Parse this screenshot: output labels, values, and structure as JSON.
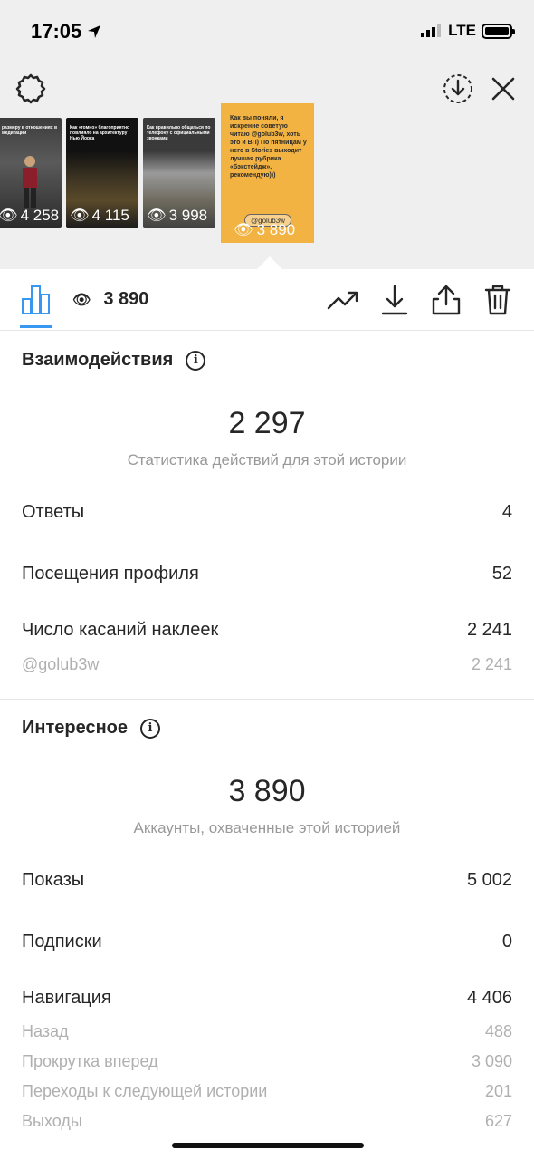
{
  "status": {
    "time": "17:05",
    "network": "LTE"
  },
  "stories": [
    {
      "caption": "размеру в отношениях в медитации",
      "views": "4 258"
    },
    {
      "caption": "Как «гомно» благоприятно повлияло на архитектуру Нью Йорка",
      "views": "4 115"
    },
    {
      "caption": "Как правильно общаться по телефону с официальными звонками",
      "views": "3 998"
    }
  ],
  "active_story": {
    "text": "Как вы поняли, я искренне советую читаю @golub3w, хоть это и ВП) По пятницам у него в Stories выходит лучшая рубрика «бэкстейдж», рекомендую)))",
    "sticker": "@golub3w",
    "views": "3 890"
  },
  "toolbar": {
    "views": "3 890"
  },
  "interactions": {
    "title": "Взаимодействия",
    "total": "2 297",
    "subtitle": "Статистика действий для этой истории",
    "replies_label": "Ответы",
    "replies_value": "4",
    "profile_visits_label": "Посещения профиля",
    "profile_visits_value": "52",
    "sticker_taps_label": "Число касаний наклеек",
    "sticker_taps_value": "2 241",
    "sticker_handle_label": "@golub3w",
    "sticker_handle_value": "2 241"
  },
  "discovery": {
    "title": "Интересное",
    "total": "3 890",
    "subtitle": "Аккаунты, охваченные этой историей",
    "impressions_label": "Показы",
    "impressions_value": "5 002",
    "follows_label": "Подписки",
    "follows_value": "0",
    "navigation_label": "Навигация",
    "navigation_value": "4 406",
    "back_label": "Назад",
    "back_value": "488",
    "forward_label": "Прокрутка вперед",
    "forward_value": "3 090",
    "next_story_label": "Переходы к следующей истории",
    "next_story_value": "201",
    "exits_label": "Выходы",
    "exits_value": "627"
  },
  "colors": {
    "accent": "#3897f0",
    "story_active_bg": "#f2b342",
    "muted_text": "#999999",
    "top_bg": "#efefef"
  }
}
